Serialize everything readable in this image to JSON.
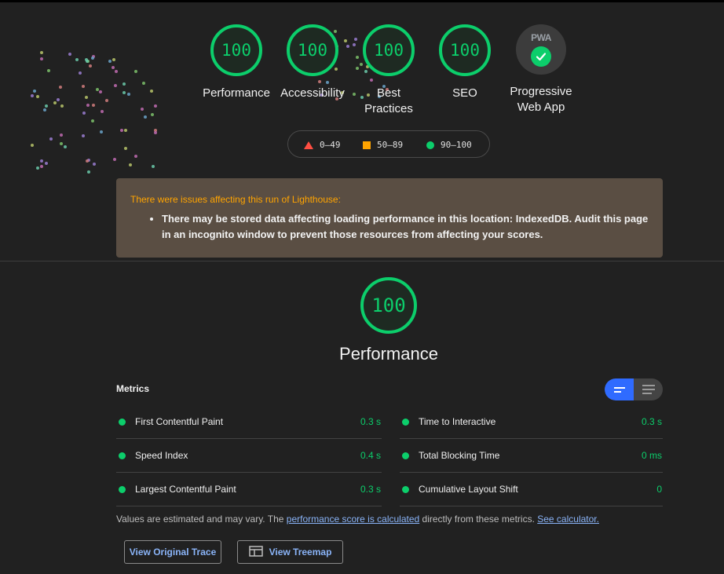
{
  "categories": [
    {
      "score": "100",
      "label": "Performance"
    },
    {
      "score": "100",
      "label": "Accessibility"
    },
    {
      "score": "100",
      "label": "Best Practices"
    },
    {
      "score": "100",
      "label": "SEO"
    }
  ],
  "pwa": {
    "badge_text": "PWA",
    "label": "Progressive Web App"
  },
  "legend": {
    "fail": "0–49",
    "average": "50–89",
    "pass": "90–100"
  },
  "warning": {
    "title": "There were issues affecting this run of Lighthouse:",
    "item": "There may be stored data affecting loading performance in this location: IndexedDB. Audit this page in an incognito window to prevent those resources from affecting your scores."
  },
  "performance": {
    "score": "100",
    "title": "Performance"
  },
  "metrics": {
    "title": "Metrics",
    "left": [
      {
        "name": "First Contentful Paint",
        "value": "0.3 s"
      },
      {
        "name": "Speed Index",
        "value": "0.4 s"
      },
      {
        "name": "Largest Contentful Paint",
        "value": "0.3 s"
      }
    ],
    "right": [
      {
        "name": "Time to Interactive",
        "value": "0.3 s"
      },
      {
        "name": "Total Blocking Time",
        "value": "0 ms"
      },
      {
        "name": "Cumulative Layout Shift",
        "value": "0"
      }
    ]
  },
  "note": {
    "prefix": "Values are estimated and may vary. The ",
    "link1": "performance score is calculated",
    "middle": " directly from these metrics. ",
    "link2": "See calculator."
  },
  "buttons": {
    "trace": "View Original Trace",
    "treemap": "View Treemap"
  },
  "colors": {
    "pass": "#0cce6b",
    "average": "#ffa400",
    "fail": "#ff4e42",
    "link": "#8ab4f8",
    "toggle_active": "#2f6bff"
  }
}
